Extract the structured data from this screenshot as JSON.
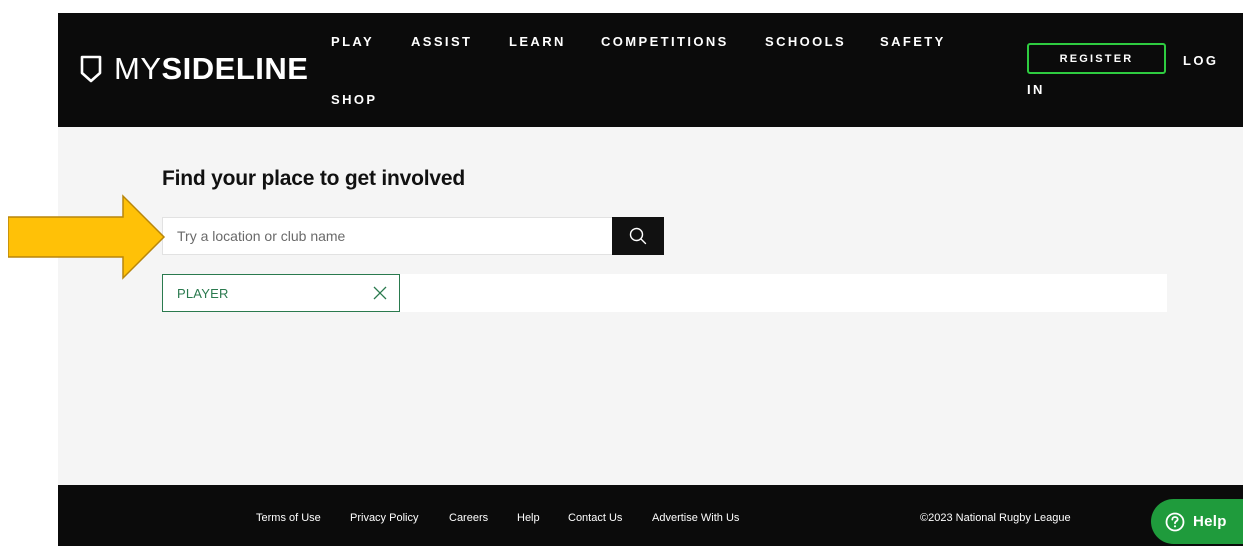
{
  "brand": {
    "logo_my": "MY",
    "logo_sideline": "SIDELINE"
  },
  "nav": {
    "items": [
      "PLAY",
      "ASSIST",
      "LEARN",
      "COMPETITIONS",
      "SCHOOLS",
      "SAFETY",
      "SHOP"
    ],
    "register_label": "REGISTER",
    "login_line1": "LOG",
    "login_line2": "IN"
  },
  "main": {
    "title": "Find your place to get involved",
    "search_placeholder": "Try a location or club name",
    "filter_chip_label": "PLAYER"
  },
  "footer": {
    "links": [
      "Terms of Use",
      "Privacy Policy",
      "Careers",
      "Help",
      "Contact Us",
      "Advertise With Us"
    ],
    "copyright": "©2023 National Rugby League"
  },
  "help_widget": {
    "label": "Help"
  },
  "icons": {
    "logo": "shield-icon",
    "search": "search-icon",
    "chip_remove": "close-icon",
    "help": "question-circle-icon",
    "annotation": "arrow-right-icon"
  },
  "colors": {
    "header_bg": "#0b0b0b",
    "accent_green": "#2ecc40",
    "chip_green": "#2a7a4e",
    "help_green": "#1f9b3c",
    "annotation_arrow": "#f5b800"
  }
}
